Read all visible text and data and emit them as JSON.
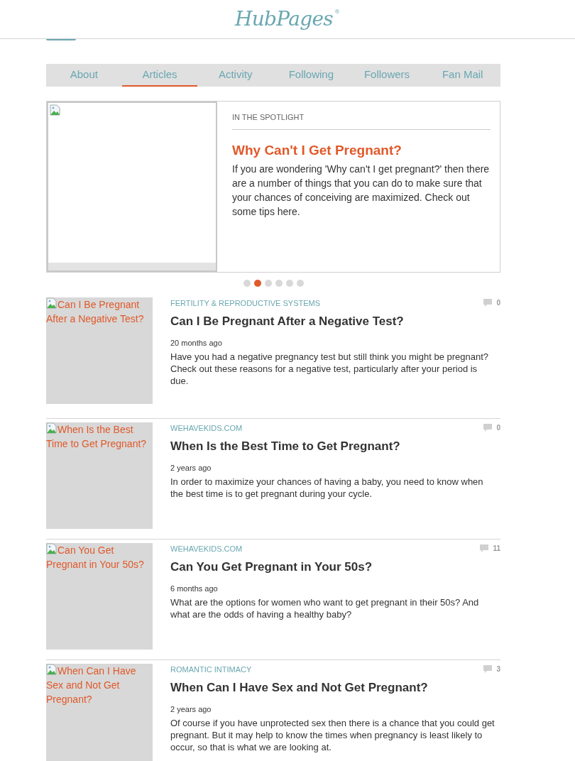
{
  "header": {
    "logo": "HubPages",
    "logo_mark": "®"
  },
  "tabs": [
    {
      "label": "About",
      "selected": false
    },
    {
      "label": "Articles",
      "selected": true
    },
    {
      "label": "Activity",
      "selected": false
    },
    {
      "label": "Following",
      "selected": false
    },
    {
      "label": "Followers",
      "selected": false
    },
    {
      "label": "Fan Mail",
      "selected": false
    }
  ],
  "spotlight": {
    "heading": "IN THE SPOTLIGHT",
    "title": "Why Can't I Get Pregnant?",
    "summary": "If you are wondering 'Why can't I get pregnant?' then there are a number of things that you can do to make sure that your chances of conceiving are maximized. Check out some tips here."
  },
  "carousel_dots": [
    {
      "selected": false
    },
    {
      "selected": true
    },
    {
      "selected": false
    },
    {
      "selected": false
    },
    {
      "selected": false
    },
    {
      "selected": false
    }
  ],
  "articles": [
    {
      "image_alt": "Can I Be Pregnant After a Negative Test?",
      "category": "FERTILITY & REPRODUCTIVE SYSTEMS",
      "comments": "0",
      "title": "Can I Be Pregnant After a Negative Test?",
      "age": "20 months ago",
      "summary": "Have you had a negative pregnancy test but still think you might be pregnant? Check out these reasons for a negative test, particularly after your period is due."
    },
    {
      "image_alt": "When Is the Best Time to Get Pregnant?",
      "category": "WEHAVEKIDS.COM",
      "comments": "0",
      "title": "When Is the Best Time to Get Pregnant?",
      "age": "2 years ago",
      "summary": "In order to maximize your chances of having a baby, you need to know when the best time is to get pregnant during your cycle."
    },
    {
      "image_alt": "Can You Get Pregnant in Your 50s?",
      "category": "WEHAVEKIDS.COM",
      "comments": "11",
      "title": "Can You Get Pregnant in Your 50s?",
      "age": "6 months ago",
      "summary": "What are the options for women who want to get pregnant in their 50s? And what are the odds of having a healthy baby?"
    },
    {
      "image_alt": "When Can I Have Sex and Not Get Pregnant?",
      "category": "ROMANTIC INTIMACY",
      "comments": "3",
      "title": "When Can I Have Sex and Not Get Pregnant?",
      "age": "2 years ago",
      "summary": "Of course if you have unprotected sex then there is a chance that you could get pregnant. But it may help to know the times when pregnancy is least likely to occur, so that is what we are looking at."
    }
  ]
}
